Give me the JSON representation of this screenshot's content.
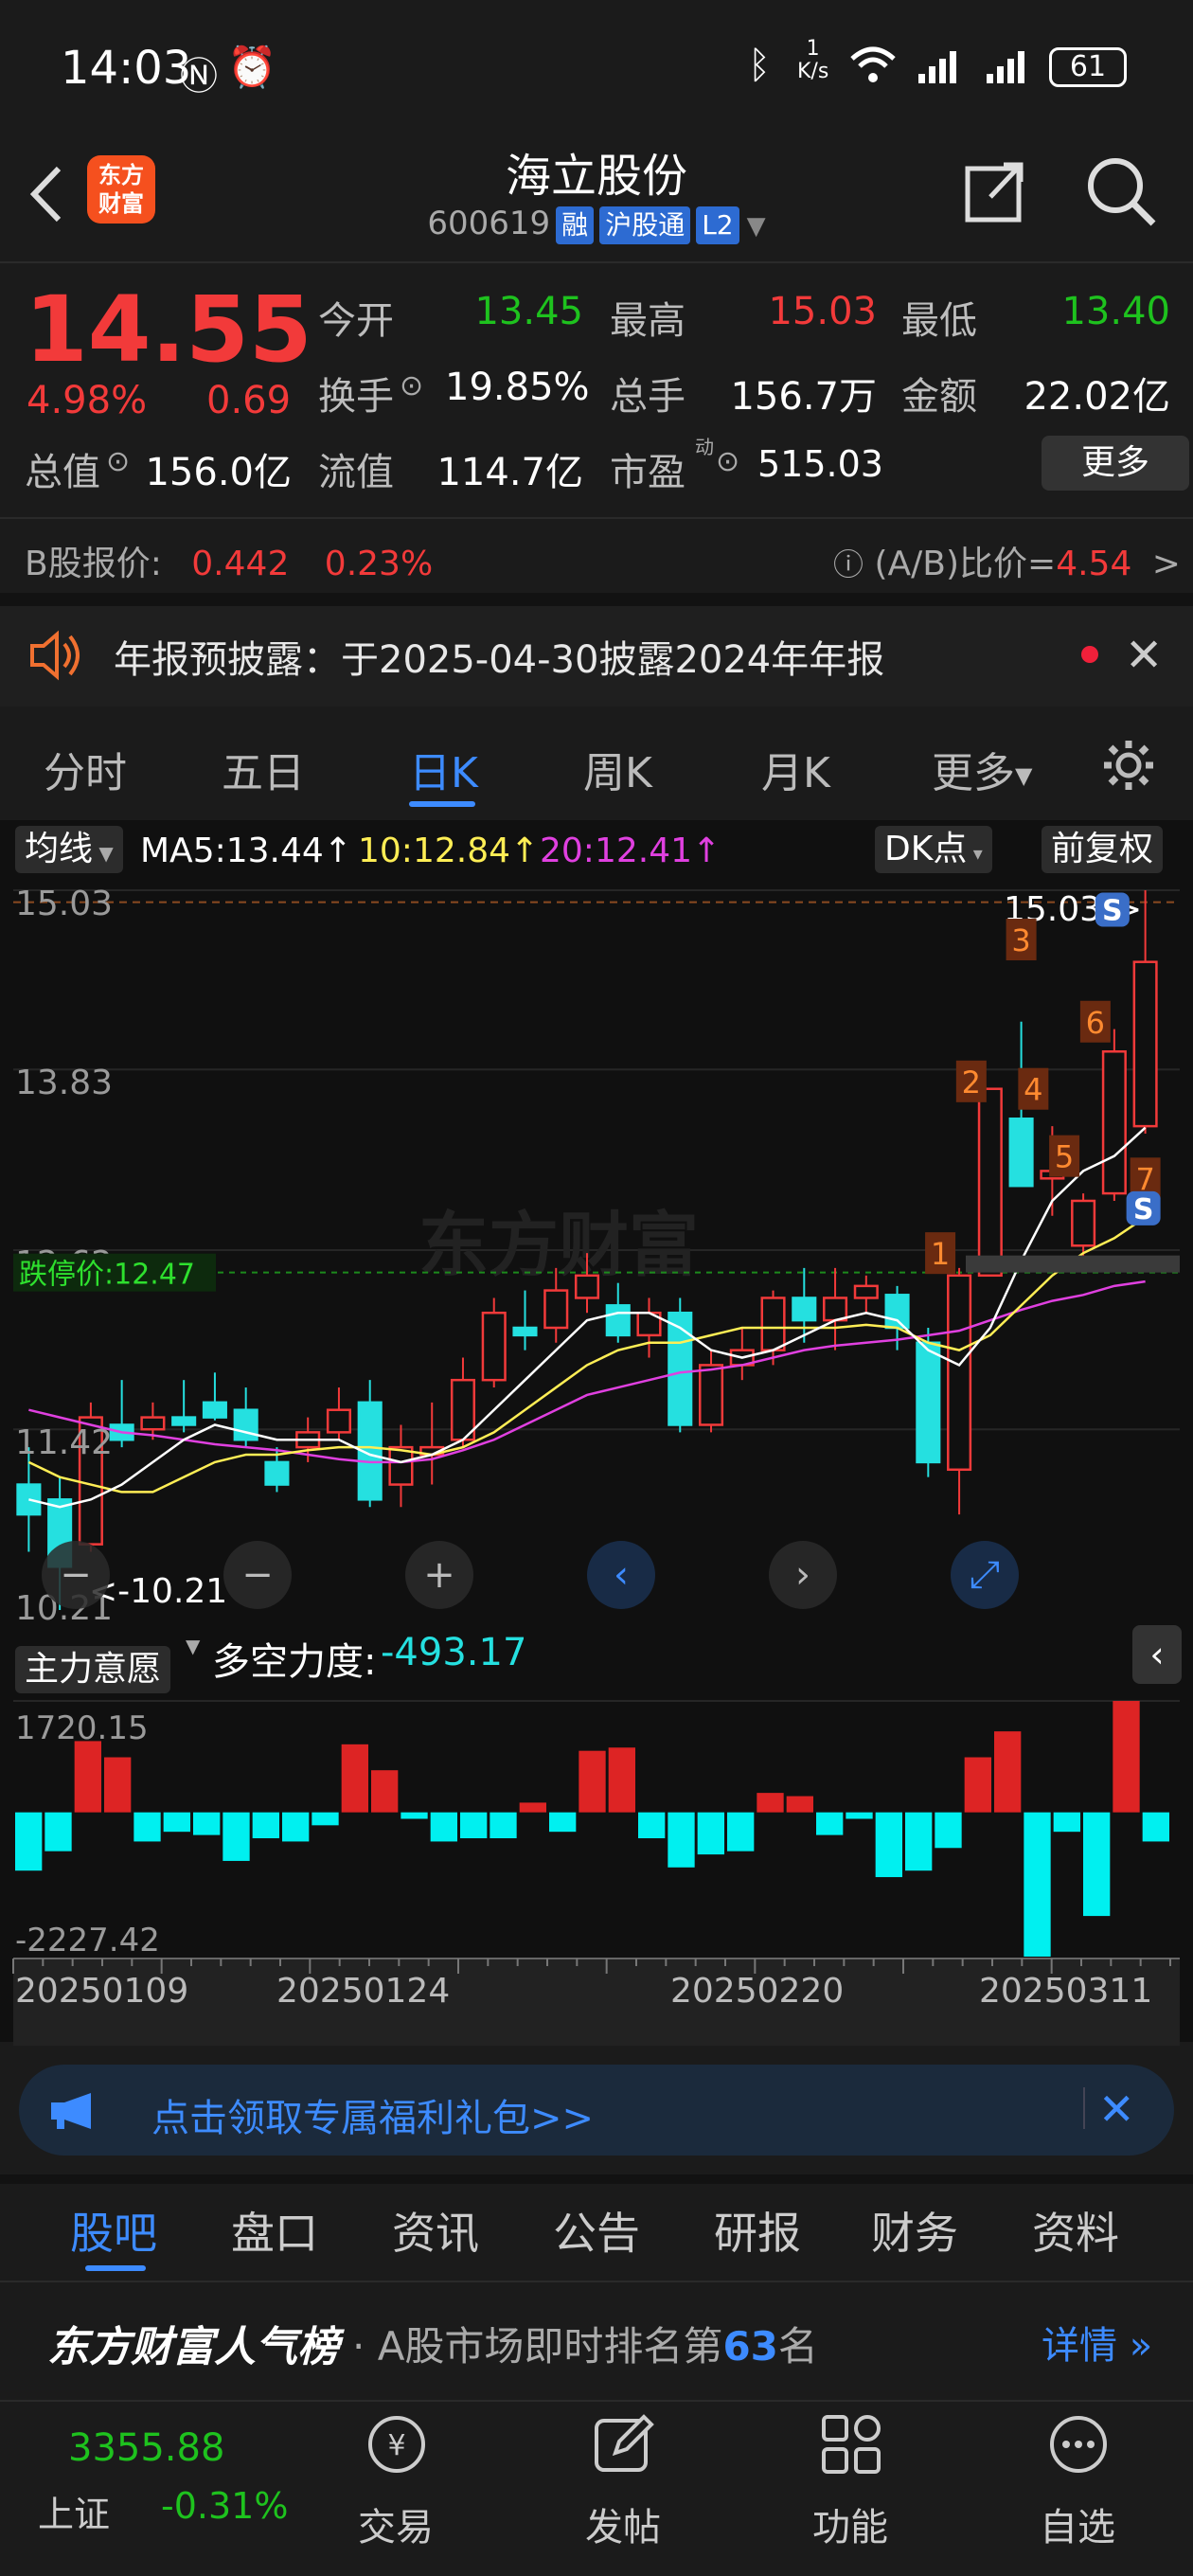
{
  "status_bar": {
    "time": "14:03",
    "net_speed_top": "1",
    "net_speed_unit": "K/s",
    "battery": "61"
  },
  "header": {
    "title": "海立股份",
    "code": "600619",
    "tags": [
      "融",
      "沪股通",
      "L2"
    ]
  },
  "quote": {
    "price": "14.55",
    "change_pct": "4.98%",
    "change": "0.69",
    "open_label": "今开",
    "open": "13.45",
    "high_label": "最高",
    "high": "15.03",
    "low_label": "最低",
    "low": "13.40",
    "turnover_label": "换手",
    "turnover": "19.85%",
    "volume_label": "总手",
    "volume": "156.7万",
    "amount_label": "金额",
    "amount": "22.02亿",
    "mktcap_label": "总值",
    "mktcap": "156.0亿",
    "float_label": "流值",
    "float": "114.7亿",
    "pe_label": "市盈",
    "pe_sup": "动",
    "pe": "515.03",
    "more_button": "更多",
    "b_label": "B股报价:",
    "b_price": "0.442",
    "b_pct": "0.23%",
    "ab_label": "(A/B)比价=",
    "ab_value": "4.54",
    "ab_arrow": ">"
  },
  "notice": {
    "text": "年报预披露：于2025-04-30披露2024年年报"
  },
  "chart_tabs": {
    "items": [
      "分时",
      "五日",
      "日K",
      "周K",
      "月K",
      "更多"
    ],
    "active": "日K"
  },
  "ma_bar": {
    "selector": "均线",
    "ma5": "MA5:13.44↑",
    "ma10": "10:12.84↑",
    "ma20": "20:12.41↑",
    "dk": "DK点",
    "adjust": "前复权"
  },
  "kchart": {
    "y_ticks": [
      "15.03",
      "13.83",
      "12.62",
      "11.42",
      "10.21"
    ],
    "limit_down_label": "跌停价:12.47",
    "max_label": "15.03->",
    "min_label": "<-10.21",
    "watermark": "东方财富",
    "markers": [
      "1",
      "2",
      "3",
      "4",
      "5",
      "6",
      "7"
    ],
    "signals": [
      "S",
      "S"
    ]
  },
  "chart_data": [
    {
      "type": "candlestick",
      "title": "",
      "ylim": [
        10.21,
        15.03
      ],
      "candles": [
        {
          "o": 11.05,
          "h": 11.3,
          "l": 10.6,
          "c": 10.85
        },
        {
          "o": 10.95,
          "h": 11.1,
          "l": 10.21,
          "c": 10.5
        },
        {
          "o": 10.65,
          "h": 11.6,
          "l": 10.6,
          "c": 11.5
        },
        {
          "o": 11.45,
          "h": 11.75,
          "l": 11.3,
          "c": 11.35
        },
        {
          "o": 11.42,
          "h": 11.6,
          "l": 11.35,
          "c": 11.5
        },
        {
          "o": 11.5,
          "h": 11.75,
          "l": 11.4,
          "c": 11.45
        },
        {
          "o": 11.6,
          "h": 11.8,
          "l": 11.48,
          "c": 11.5
        },
        {
          "o": 11.55,
          "h": 11.7,
          "l": 11.3,
          "c": 11.35
        },
        {
          "o": 11.2,
          "h": 11.3,
          "l": 11.0,
          "c": 11.05
        },
        {
          "o": 11.3,
          "h": 11.5,
          "l": 11.2,
          "c": 11.4
        },
        {
          "o": 11.4,
          "h": 11.7,
          "l": 11.35,
          "c": 11.55
        },
        {
          "o": 11.6,
          "h": 11.75,
          "l": 10.9,
          "c": 10.95
        },
        {
          "o": 11.05,
          "h": 11.45,
          "l": 10.9,
          "c": 11.3
        },
        {
          "o": 11.25,
          "h": 11.6,
          "l": 11.05,
          "c": 11.3
        },
        {
          "o": 11.35,
          "h": 11.9,
          "l": 11.3,
          "c": 11.75
        },
        {
          "o": 11.75,
          "h": 12.3,
          "l": 11.7,
          "c": 12.2
        },
        {
          "o": 12.1,
          "h": 12.35,
          "l": 11.95,
          "c": 12.05
        },
        {
          "o": 12.1,
          "h": 12.5,
          "l": 12.0,
          "c": 12.35
        },
        {
          "o": 12.3,
          "h": 12.6,
          "l": 12.2,
          "c": 12.45
        },
        {
          "o": 12.25,
          "h": 12.4,
          "l": 12.0,
          "c": 12.05
        },
        {
          "o": 12.05,
          "h": 12.3,
          "l": 11.9,
          "c": 12.2
        },
        {
          "o": 12.2,
          "h": 12.3,
          "l": 11.4,
          "c": 11.45
        },
        {
          "o": 11.45,
          "h": 11.95,
          "l": 11.4,
          "c": 11.85
        },
        {
          "o": 11.85,
          "h": 12.1,
          "l": 11.75,
          "c": 11.95
        },
        {
          "o": 11.95,
          "h": 12.35,
          "l": 11.85,
          "c": 12.3
        },
        {
          "o": 12.3,
          "h": 12.5,
          "l": 12.0,
          "c": 12.15
        },
        {
          "o": 12.15,
          "h": 12.5,
          "l": 11.95,
          "c": 12.3
        },
        {
          "o": 12.3,
          "h": 12.45,
          "l": 12.2,
          "c": 12.38
        },
        {
          "o": 12.32,
          "h": 12.38,
          "l": 11.95,
          "c": 12.1
        },
        {
          "o": 12.0,
          "h": 12.1,
          "l": 11.1,
          "c": 11.2
        },
        {
          "o": 11.15,
          "h": 12.5,
          "l": 10.85,
          "c": 12.45
        },
        {
          "o": 12.45,
          "h": 13.7,
          "l": 12.45,
          "c": 13.7
        },
        {
          "o": 13.5,
          "h": 14.15,
          "l": 13.1,
          "c": 13.05
        },
        {
          "o": 13.1,
          "h": 13.45,
          "l": 12.85,
          "c": 13.15
        },
        {
          "o": 12.65,
          "h": 13.0,
          "l": 12.55,
          "c": 12.95
        },
        {
          "o": 13.0,
          "h": 14.1,
          "l": 12.95,
          "c": 13.95
        },
        {
          "o": 13.45,
          "h": 15.03,
          "l": 13.4,
          "c": 14.55
        }
      ],
      "ma5": [
        10.95,
        10.9,
        10.95,
        11.05,
        11.2,
        11.35,
        11.45,
        11.4,
        11.35,
        11.35,
        11.35,
        11.25,
        11.2,
        11.25,
        11.35,
        11.55,
        11.75,
        11.95,
        12.15,
        12.2,
        12.2,
        12.1,
        11.95,
        11.9,
        11.95,
        12.05,
        12.15,
        12.2,
        12.15,
        11.95,
        11.85,
        12.1,
        12.55,
        12.95,
        13.15,
        13.25,
        13.44
      ],
      "ma10": [
        11.2,
        11.1,
        11.05,
        11.0,
        11.0,
        11.1,
        11.2,
        11.25,
        11.25,
        11.28,
        11.3,
        11.3,
        11.28,
        11.25,
        11.3,
        11.4,
        11.55,
        11.7,
        11.85,
        11.95,
        12.0,
        12.0,
        12.05,
        12.1,
        12.1,
        12.1,
        12.1,
        12.12,
        12.1,
        12.0,
        11.95,
        12.05,
        12.25,
        12.45,
        12.6,
        12.7,
        12.84
      ],
      "ma20": [
        11.55,
        11.5,
        11.45,
        11.4,
        11.38,
        11.35,
        11.32,
        11.3,
        11.28,
        11.25,
        11.22,
        11.2,
        11.2,
        11.22,
        11.28,
        11.35,
        11.45,
        11.55,
        11.65,
        11.7,
        11.75,
        11.8,
        11.82,
        11.85,
        11.9,
        11.95,
        11.98,
        12.0,
        12.02,
        12.05,
        12.08,
        12.15,
        12.22,
        12.28,
        12.32,
        12.38,
        12.41
      ],
      "limit_down": 12.47
    },
    {
      "type": "bar",
      "title": "主力意愿",
      "ylim": [
        -2227.42,
        1720.15
      ],
      "values": [
        -900,
        -600,
        1100,
        850,
        -450,
        -300,
        -350,
        -750,
        -400,
        -450,
        -200,
        1050,
        650,
        -100,
        -450,
        -400,
        -400,
        150,
        -300,
        950,
        1000,
        -400,
        -850,
        -650,
        -600,
        300,
        250,
        -350,
        -100,
        -1000,
        -900,
        -550,
        850,
        1250,
        -2227,
        -300,
        -1600,
        1720,
        -450
      ],
      "x_ticks": [
        "20250109",
        "20250124",
        "20250220",
        "20250311"
      ]
    }
  ],
  "indicator": {
    "selector": "主力意愿",
    "label": "多空力度:",
    "value": "-493.17",
    "y_top": "1720.15",
    "y_bottom": "-2227.42"
  },
  "x_ticks": [
    "20250109",
    "20250124",
    "20250220",
    "20250311"
  ],
  "banner": {
    "text": "点击领取专属福利礼包>>"
  },
  "bottom_tabs": {
    "items": [
      "股吧",
      "盘口",
      "资讯",
      "公告",
      "研报",
      "财务",
      "资料"
    ],
    "active": "股吧"
  },
  "rank": {
    "title": "东方财富人气榜",
    "text_prefix": "· A股市场即时排名第",
    "rank": "63",
    "text_suffix": "名",
    "detail": "详情"
  },
  "bottom_nav": {
    "index_value": "3355.88",
    "index_name": "上证",
    "index_pct": "-0.31%",
    "items": [
      "交易",
      "发帖",
      "功能",
      "自选"
    ]
  },
  "colors": {
    "up": "#f23a3a",
    "down": "#1ec21e",
    "cyan": "#25e0e0",
    "accent": "#3d8bff",
    "ma5": "#ffffff",
    "ma10": "#ffee55",
    "ma20": "#e040e0"
  }
}
